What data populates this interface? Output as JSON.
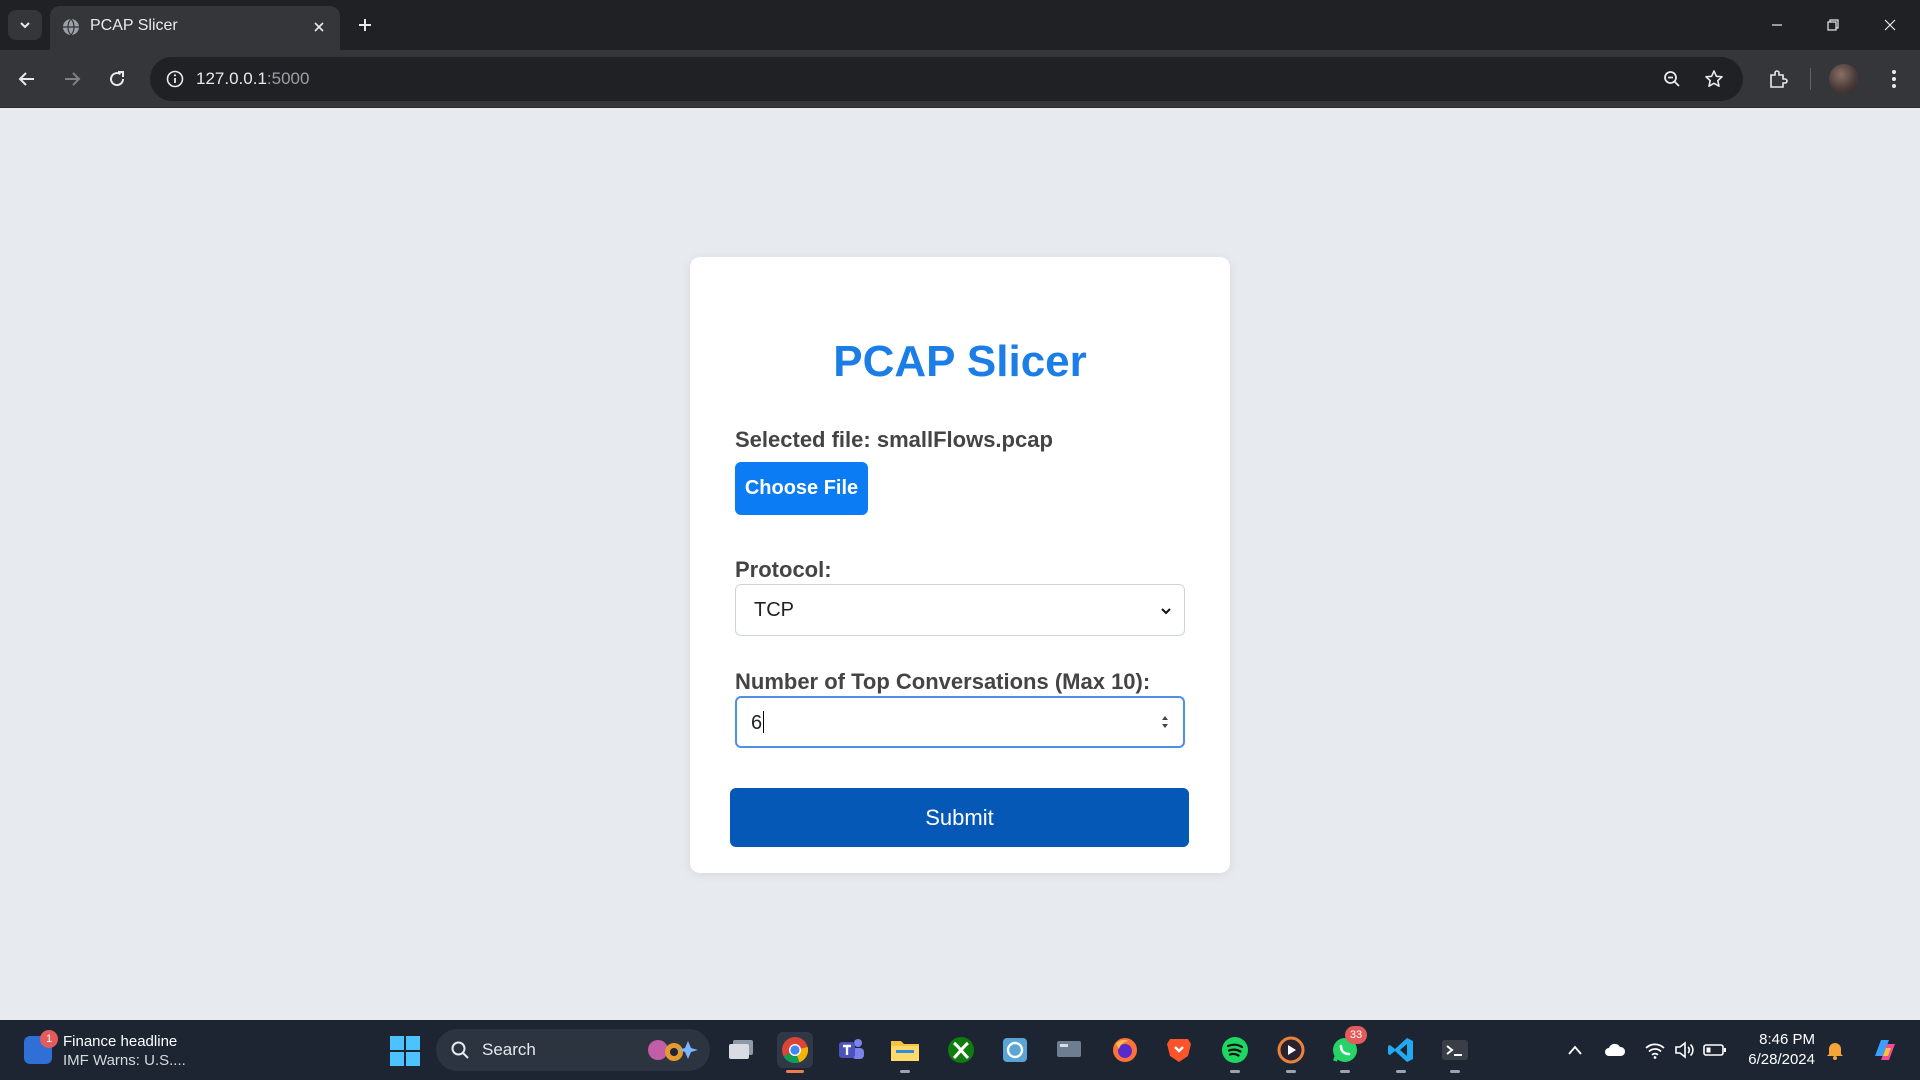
{
  "browser": {
    "tab_title": "PCAP Slicer",
    "url_host": "127.0.0.1",
    "url_port": ":5000"
  },
  "page": {
    "title": "PCAP Slicer",
    "selected_file_label": "Selected file: smallFlows.pcap",
    "choose_file_label": "Choose File",
    "protocol_label": "Protocol:",
    "protocol_value": "TCP",
    "top_conversations_label": "Number of Top Conversations (Max 10):",
    "top_conversations_value": "6",
    "submit_label": "Submit"
  },
  "taskbar": {
    "news_title": "Finance headline",
    "news_subtitle": "IMF Warns: U.S....",
    "news_badge": "1",
    "search_label": "Search",
    "whatsapp_badge": "33",
    "time": "8:46 PM",
    "date": "6/28/2024"
  },
  "colors": {
    "title_blue": "#1a7ee6",
    "choose_button": "#0b7cf3",
    "submit_button": "#0558b5",
    "page_background": "#e7ebef"
  }
}
